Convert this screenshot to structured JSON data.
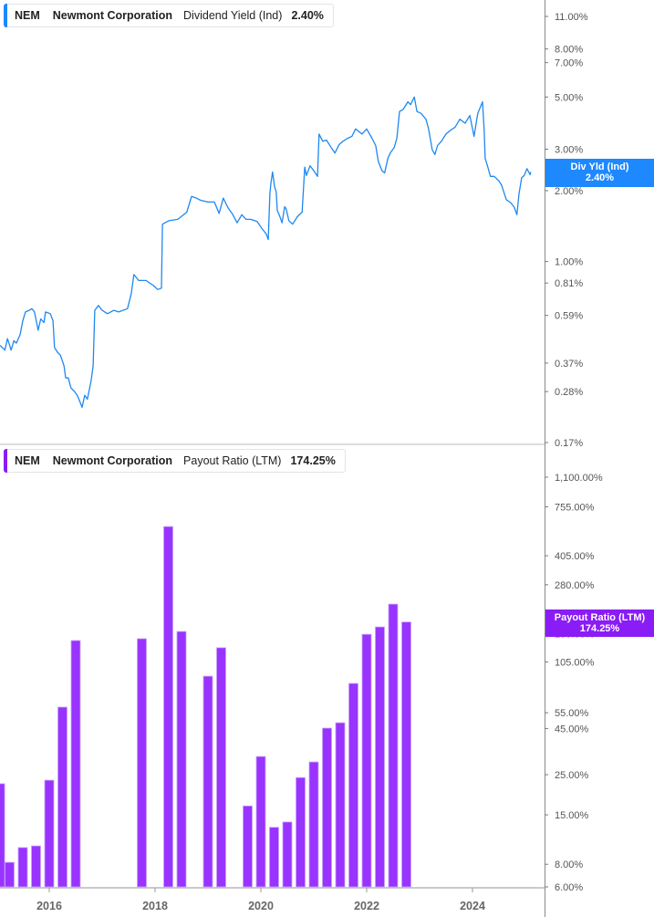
{
  "colors": {
    "yield_line": "#1e88f0",
    "payout_bar": "#9933ff",
    "yield_tag": "#1e88ff",
    "payout_tag": "#8a1cf5"
  },
  "top_legend": {
    "ticker": "NEM",
    "company": "Newmont Corporation",
    "metric": "Dividend Yield (Ind)",
    "value": "2.40%"
  },
  "bottom_legend": {
    "ticker": "NEM",
    "company": "Newmont Corporation",
    "metric": "Payout Ratio (LTM)",
    "value": "174.25%"
  },
  "yield_tag": {
    "label": "Div Yld (Ind)",
    "value": "2.40%"
  },
  "payout_tag": {
    "label": "Payout Ratio (LTM)",
    "value": "174.25%"
  },
  "chart_data": [
    {
      "type": "line",
      "title": "NEM Dividend Yield (Ind)",
      "scale": "log",
      "ylim": [
        0.17,
        11.0
      ],
      "y_ticks": [
        11.0,
        8.0,
        7.0,
        5.0,
        3.0,
        2.0,
        1.0,
        0.81,
        0.59,
        0.37,
        0.28,
        0.17
      ],
      "y_tick_labels": [
        "11.00%",
        "8.00%",
        "7.00%",
        "5.00%",
        "3.00%",
        "2.00%",
        "1.00%",
        "0.81%",
        "0.59%",
        "0.37%",
        "0.28%",
        "0.17%"
      ],
      "xlim": [
        2015.07,
        2025.4
      ],
      "series": [
        {
          "name": "Dividend Yield (Ind)",
          "unit": "%",
          "points": [
            [
              2015.07,
              0.44
            ],
            [
              2015.16,
              0.42
            ],
            [
              2015.21,
              0.47
            ],
            [
              2015.28,
              0.42
            ],
            [
              2015.33,
              0.46
            ],
            [
              2015.38,
              0.45
            ],
            [
              2015.45,
              0.49
            ],
            [
              2015.5,
              0.56
            ],
            [
              2015.55,
              0.61
            ],
            [
              2015.62,
              0.62
            ],
            [
              2015.67,
              0.63
            ],
            [
              2015.72,
              0.61
            ],
            [
              2015.79,
              0.51
            ],
            [
              2015.84,
              0.57
            ],
            [
              2015.9,
              0.55
            ],
            [
              2015.93,
              0.61
            ],
            [
              2016.02,
              0.6
            ],
            [
              2016.07,
              0.56
            ],
            [
              2016.1,
              0.43
            ],
            [
              2016.16,
              0.41
            ],
            [
              2016.21,
              0.4
            ],
            [
              2016.28,
              0.36
            ],
            [
              2016.31,
              0.32
            ],
            [
              2016.36,
              0.32
            ],
            [
              2016.41,
              0.29
            ],
            [
              2016.48,
              0.28
            ],
            [
              2016.53,
              0.27
            ],
            [
              2016.59,
              0.25
            ],
            [
              2016.62,
              0.24
            ],
            [
              2016.67,
              0.27
            ],
            [
              2016.72,
              0.26
            ],
            [
              2016.79,
              0.31
            ],
            [
              2016.83,
              0.36
            ],
            [
              2016.86,
              0.62
            ],
            [
              2016.93,
              0.65
            ],
            [
              2017.0,
              0.62
            ],
            [
              2017.1,
              0.6
            ],
            [
              2017.22,
              0.62
            ],
            [
              2017.31,
              0.61
            ],
            [
              2017.48,
              0.63
            ],
            [
              2017.55,
              0.73
            ],
            [
              2017.6,
              0.88
            ],
            [
              2017.69,
              0.83
            ],
            [
              2017.83,
              0.83
            ],
            [
              2017.97,
              0.79
            ],
            [
              2018.05,
              0.76
            ],
            [
              2018.12,
              0.77
            ],
            [
              2018.14,
              1.44
            ],
            [
              2018.26,
              1.49
            ],
            [
              2018.43,
              1.51
            ],
            [
              2018.6,
              1.62
            ],
            [
              2018.69,
              1.89
            ],
            [
              2018.78,
              1.86
            ],
            [
              2018.86,
              1.82
            ],
            [
              2019.0,
              1.79
            ],
            [
              2019.12,
              1.79
            ],
            [
              2019.21,
              1.6
            ],
            [
              2019.29,
              1.86
            ],
            [
              2019.38,
              1.69
            ],
            [
              2019.47,
              1.58
            ],
            [
              2019.55,
              1.46
            ],
            [
              2019.64,
              1.58
            ],
            [
              2019.72,
              1.51
            ],
            [
              2019.81,
              1.51
            ],
            [
              2019.93,
              1.48
            ],
            [
              2020.02,
              1.38
            ],
            [
              2020.1,
              1.31
            ],
            [
              2020.14,
              1.24
            ],
            [
              2020.17,
              1.94
            ],
            [
              2020.19,
              2.15
            ],
            [
              2020.22,
              2.4
            ],
            [
              2020.26,
              2.07
            ],
            [
              2020.29,
              1.98
            ],
            [
              2020.31,
              1.65
            ],
            [
              2020.36,
              1.55
            ],
            [
              2020.4,
              1.46
            ],
            [
              2020.45,
              1.71
            ],
            [
              2020.48,
              1.67
            ],
            [
              2020.53,
              1.49
            ],
            [
              2020.6,
              1.44
            ],
            [
              2020.69,
              1.55
            ],
            [
              2020.78,
              1.62
            ],
            [
              2020.83,
              2.52
            ],
            [
              2020.86,
              2.32
            ],
            [
              2020.93,
              2.55
            ],
            [
              2021.0,
              2.43
            ],
            [
              2021.07,
              2.3
            ],
            [
              2021.1,
              3.48
            ],
            [
              2021.17,
              3.24
            ],
            [
              2021.24,
              3.28
            ],
            [
              2021.33,
              3.05
            ],
            [
              2021.4,
              2.89
            ],
            [
              2021.48,
              3.14
            ],
            [
              2021.55,
              3.24
            ],
            [
              2021.64,
              3.34
            ],
            [
              2021.72,
              3.4
            ],
            [
              2021.79,
              3.66
            ],
            [
              2021.91,
              3.48
            ],
            [
              2022.0,
              3.66
            ],
            [
              2022.1,
              3.34
            ],
            [
              2022.17,
              3.11
            ],
            [
              2022.22,
              2.66
            ],
            [
              2022.29,
              2.43
            ],
            [
              2022.34,
              2.38
            ],
            [
              2022.4,
              2.74
            ],
            [
              2022.45,
              2.9
            ],
            [
              2022.52,
              3.05
            ],
            [
              2022.57,
              3.34
            ],
            [
              2022.62,
              4.34
            ],
            [
              2022.69,
              4.43
            ],
            [
              2022.78,
              4.77
            ],
            [
              2022.83,
              4.64
            ],
            [
              2022.9,
              5.0
            ],
            [
              2022.95,
              4.34
            ],
            [
              2023.03,
              4.26
            ],
            [
              2023.12,
              4.02
            ],
            [
              2023.17,
              3.66
            ],
            [
              2023.24,
              2.98
            ],
            [
              2023.29,
              2.85
            ],
            [
              2023.34,
              3.11
            ],
            [
              2023.41,
              3.24
            ],
            [
              2023.5,
              3.48
            ],
            [
              2023.59,
              3.62
            ],
            [
              2023.67,
              3.72
            ],
            [
              2023.76,
              4.02
            ],
            [
              2023.86,
              3.87
            ],
            [
              2023.95,
              4.17
            ],
            [
              2024.03,
              3.4
            ],
            [
              2024.1,
              4.26
            ],
            [
              2024.19,
              4.77
            ],
            [
              2024.22,
              3.62
            ],
            [
              2024.24,
              2.74
            ],
            [
              2024.29,
              2.52
            ],
            [
              2024.34,
              2.3
            ],
            [
              2024.41,
              2.3
            ],
            [
              2024.5,
              2.2
            ],
            [
              2024.55,
              2.11
            ],
            [
              2024.64,
              1.83
            ],
            [
              2024.72,
              1.78
            ],
            [
              2024.79,
              1.7
            ],
            [
              2024.84,
              1.58
            ],
            [
              2024.88,
              1.94
            ],
            [
              2024.93,
              2.27
            ],
            [
              2024.98,
              2.32
            ],
            [
              2025.03,
              2.48
            ],
            [
              2025.09,
              2.34
            ],
            [
              2025.1,
              2.4
            ]
          ]
        }
      ]
    },
    {
      "type": "bar",
      "title": "NEM Payout Ratio (LTM)",
      "scale": "log",
      "ylim": [
        6.0,
        1100.0
      ],
      "y_ticks": [
        1100,
        755,
        405,
        280,
        150,
        105,
        55,
        45,
        25,
        15,
        8,
        6
      ],
      "y_tick_labels": [
        "1,100.00%",
        "755.00%",
        "405.00%",
        "280.00%",
        "150.00%",
        "105.00%",
        "55.00%",
        "45.00%",
        "25.00%",
        "15.00%",
        "8.00%",
        "6.00%"
      ],
      "x_ticks": [
        2016,
        2018,
        2020,
        2022,
        2024
      ],
      "x_tick_labels": [
        "2016",
        "2018",
        "2020",
        "2022",
        "2024"
      ],
      "xlim": [
        2015.07,
        2025.4
      ],
      "series": [
        {
          "name": "Payout Ratio (LTM)",
          "unit": "%",
          "points": [
            [
              2015.07,
              22.3
            ],
            [
              2015.25,
              8.2
            ],
            [
              2015.5,
              9.9
            ],
            [
              2015.75,
              10.1
            ],
            [
              2016.0,
              23.3
            ],
            [
              2016.25,
              59.0
            ],
            [
              2016.5,
              137.7
            ],
            [
              2017.75,
              141.0
            ],
            [
              2018.25,
              587.0
            ],
            [
              2018.5,
              154.5
            ],
            [
              2019.0,
              87.5
            ],
            [
              2019.25,
              125.6
            ],
            [
              2019.75,
              16.8
            ],
            [
              2020.0,
              31.5
            ],
            [
              2020.25,
              12.8
            ],
            [
              2020.5,
              13.7
            ],
            [
              2020.75,
              24.1
            ],
            [
              2021.0,
              29.4
            ],
            [
              2021.25,
              45.2
            ],
            [
              2021.5,
              48.4
            ],
            [
              2021.75,
              79.8
            ],
            [
              2022.0,
              149.0
            ],
            [
              2022.25,
              163.8
            ],
            [
              2022.5,
              218.9
            ],
            [
              2022.75,
              174.25
            ]
          ]
        }
      ]
    }
  ]
}
